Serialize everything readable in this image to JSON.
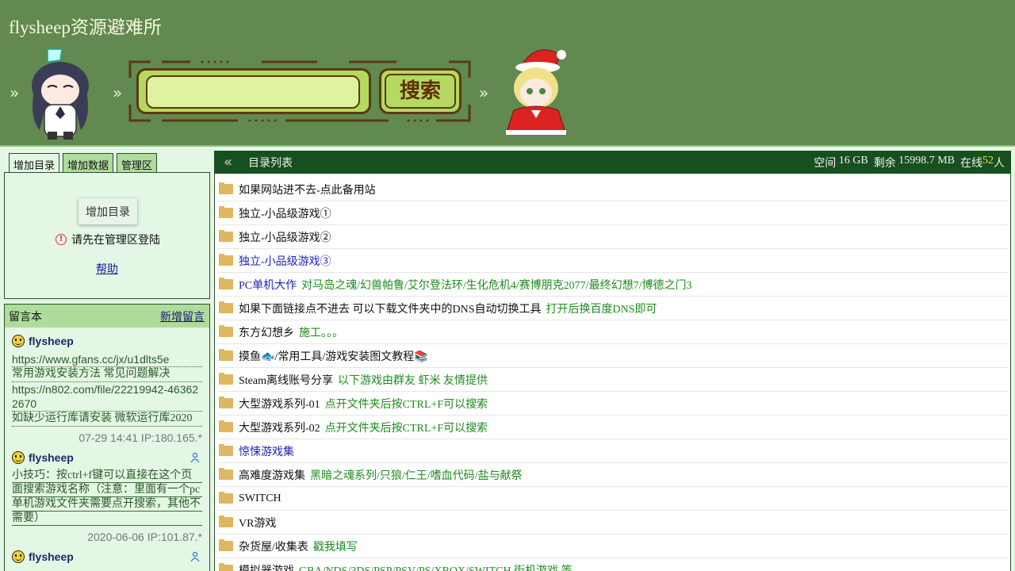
{
  "site": {
    "title": "flysheep资源避难所",
    "separator": "»"
  },
  "search": {
    "placeholder": "",
    "button_label": "搜索"
  },
  "left": {
    "tabs": [
      {
        "label": "增加目录",
        "active": true
      },
      {
        "label": "增加数据",
        "active": false
      },
      {
        "label": "管理区",
        "active": false
      }
    ],
    "add_button": "增加目录",
    "login_notice": "请先在管理区登陆",
    "help": "帮助"
  },
  "guestbook": {
    "title": "留言本",
    "new_link": "新增留言",
    "entries": [
      {
        "user": "flysheep",
        "lines": [
          "https://www.gfans.cc/jx/u1dlts5e",
          "常用游戏安装方法 常见问题解决",
          "https://n802.com/file/22219942-463622670",
          "如缺少运行库请安装 微软运行库2020"
        ],
        "meta": "07-29 14:41 IP:180.165.*"
      },
      {
        "user": "flysheep",
        "lines": [
          "小技巧：按ctrl+f键可以直接在这个页面搜索游戏名称（注意：里面有一个pc单机游戏文件夹需要点开搜索，其他不需要）"
        ],
        "meta": "2020-06-06 IP:101.87.*"
      },
      {
        "user": "flysheep",
        "lines": [],
        "meta": ""
      }
    ]
  },
  "main": {
    "title": "目录列表",
    "stats": {
      "space_label": "空间",
      "space_value": "16 GB",
      "remain_label": "剩余",
      "remain_value": "15998.7 MB",
      "online_label": "在线",
      "online_value": "52",
      "online_unit": "人"
    },
    "rows": [
      {
        "name": "如果网站进不去-点此备用站",
        "note": "",
        "link": false
      },
      {
        "name": "独立-小品级游戏①",
        "note": "",
        "link": false
      },
      {
        "name": "独立-小品级游戏②",
        "note": "",
        "link": false
      },
      {
        "name": "独立-小品级游戏③",
        "note": "",
        "link": true
      },
      {
        "name": "PC单机大作",
        "note": "对马岛之魂/幻兽帕鲁/艾尔登法环/生化危机4/赛博朋克2077/最终幻想7/博德之门3",
        "link": true
      },
      {
        "name": "如果下面链接点不进去 可以下载文件夹中的DNS自动切换工具",
        "note": "打开后换百度DNS即可",
        "link": false
      },
      {
        "name": "东方幻想乡",
        "note": "施工。。。",
        "link": false
      },
      {
        "name": "摸鱼🐟/常用工具/游戏安装图文教程📚",
        "note": "",
        "link": false
      },
      {
        "name": "Steam离线账号分享",
        "note": "以下游戏由群友 虾米 友情提供",
        "link": false
      },
      {
        "name": "大型游戏系列-01",
        "note": "点开文件夹后按CTRL+F可以搜索",
        "link": false
      },
      {
        "name": "大型游戏系列-02",
        "note": "点开文件夹后按CTRL+F可以搜索",
        "link": false
      },
      {
        "name": "惊悚游戏集",
        "note": "",
        "link": true
      },
      {
        "name": "高难度游戏集",
        "note": "黑暗之魂系列/只狼/仁王/嗜血代码/盐与献祭",
        "link": false
      },
      {
        "name": "SWITCH",
        "note": "",
        "link": false
      },
      {
        "name": "VR游戏",
        "note": "",
        "link": false
      },
      {
        "name": "杂货屋/收集表",
        "note": "戳我填写",
        "link": false
      },
      {
        "name": "模拟器游戏",
        "note": "GBA/NDS/3DS/PSP/PSV/PS/XBOX/SWITCH 街机游戏 等",
        "link": false
      }
    ]
  },
  "colors": {
    "header_bg": "#62894f",
    "panel_bg": "#e4f6e4",
    "tab_bg": "#aedc9c",
    "main_head_bg": "#174f1e",
    "note_green": "#1e8a1e",
    "link_blue": "#2222bb"
  }
}
